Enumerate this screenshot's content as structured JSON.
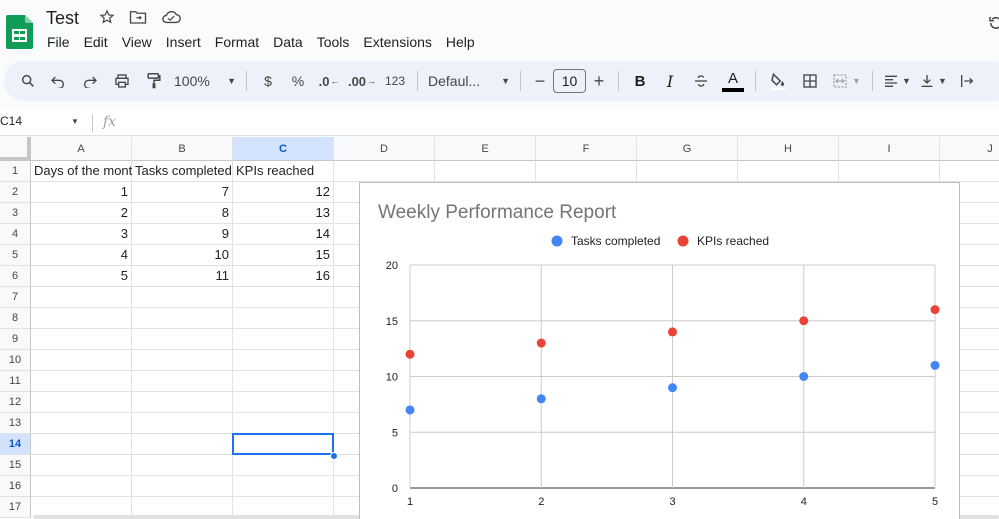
{
  "app": {
    "doc_title": "Test",
    "menu": [
      "File",
      "Edit",
      "View",
      "Insert",
      "Format",
      "Data",
      "Tools",
      "Extensions",
      "Help"
    ]
  },
  "toolbar": {
    "zoom": "100%",
    "currency": "$",
    "percent": "%",
    "dec_decrease": ".0",
    "dec_increase": ".00",
    "number_format": "123",
    "font": "Defaul...",
    "font_size": "10",
    "minus": "−",
    "plus": "+",
    "bold": "B",
    "italic": "I",
    "text_color": "A"
  },
  "formula_bar": {
    "name_box": "C14",
    "fx": "fx"
  },
  "grid": {
    "columns": [
      "A",
      "B",
      "C",
      "D",
      "E",
      "F",
      "G",
      "H",
      "I",
      "J"
    ],
    "selected_column": "C",
    "rows": [
      "1",
      "2",
      "3",
      "4",
      "5",
      "6",
      "7",
      "8",
      "9",
      "10",
      "11",
      "12",
      "13",
      "14",
      "15",
      "16",
      "17"
    ],
    "selected_row": "14",
    "headers": [
      "Days of the month",
      "Tasks completed",
      "KPIs reached"
    ],
    "data": [
      [
        "1",
        "7",
        "12"
      ],
      [
        "2",
        "8",
        "13"
      ],
      [
        "3",
        "9",
        "14"
      ],
      [
        "4",
        "10",
        "15"
      ],
      [
        "5",
        "11",
        "16"
      ]
    ]
  },
  "chart_data": {
    "type": "scatter",
    "title": "Weekly Performance Report",
    "x": [
      1,
      2,
      3,
      4,
      5
    ],
    "x_ticks": [
      "1",
      "2",
      "3",
      "4",
      "5"
    ],
    "y_ticks": [
      "0",
      "5",
      "10",
      "15",
      "20"
    ],
    "ylim": [
      0,
      20
    ],
    "xlim": [
      1,
      5
    ],
    "grid": true,
    "legend_position": "top",
    "series": [
      {
        "name": "Tasks completed",
        "values": [
          7,
          8,
          9,
          10,
          11
        ],
        "color": "#4285f4"
      },
      {
        "name": "KPIs reached",
        "values": [
          12,
          13,
          14,
          15,
          16
        ],
        "color": "#ea4335"
      }
    ]
  },
  "colors": {
    "accent": "#1a73e8",
    "sheets_green": "#0f9d58",
    "toolbar_bg": "#edf2fa"
  }
}
